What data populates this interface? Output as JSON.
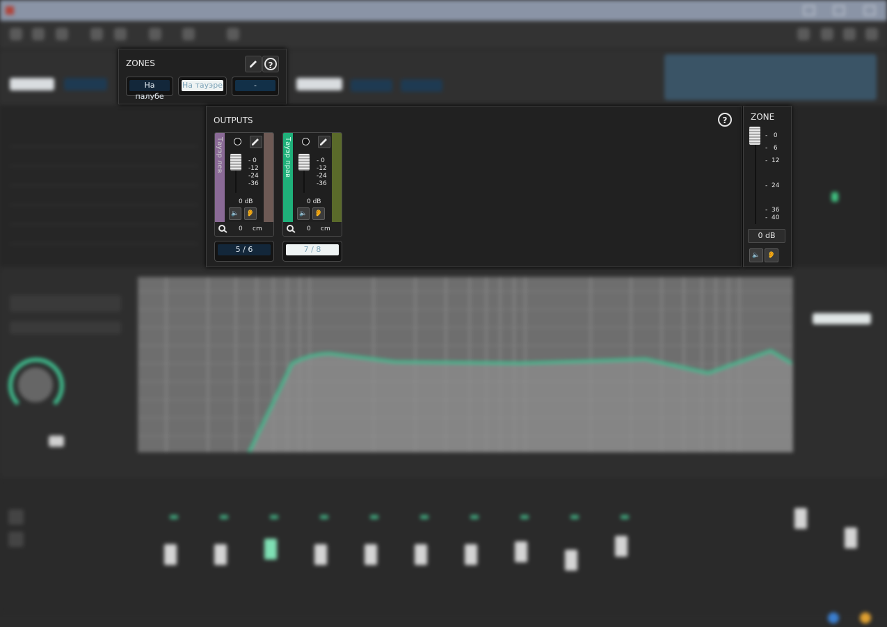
{
  "zones_panel": {
    "title": "ZONES",
    "zones": [
      {
        "label": "На палубе",
        "state": "selected"
      },
      {
        "label": "На тауэре",
        "state": "active"
      },
      {
        "label": "-",
        "state": "empty"
      }
    ]
  },
  "outputs_panel": {
    "title": "OUTPUTS",
    "channels": [
      {
        "name": "Тауэр лев",
        "gain": "0 dB",
        "delay_value": "0",
        "delay_unit": "cm",
        "pair": "5 / 6",
        "left_color": "#8a6a96",
        "right_color": "#6e5a55"
      },
      {
        "name": "Тауэр прав",
        "gain": "0 dB",
        "delay_value": "0",
        "delay_unit": "cm",
        "pair": "7 / 8",
        "left_color": "#1fb07a",
        "right_color": "#5a6a2a"
      }
    ],
    "scale": [
      "0",
      "12",
      "24",
      "36"
    ]
  },
  "zone_panel": {
    "title": "ZONE",
    "gain": "0 dB",
    "scale": [
      "0",
      "6",
      "12",
      "24",
      "36",
      "40"
    ]
  },
  "accent_color": "#3fbf8f"
}
